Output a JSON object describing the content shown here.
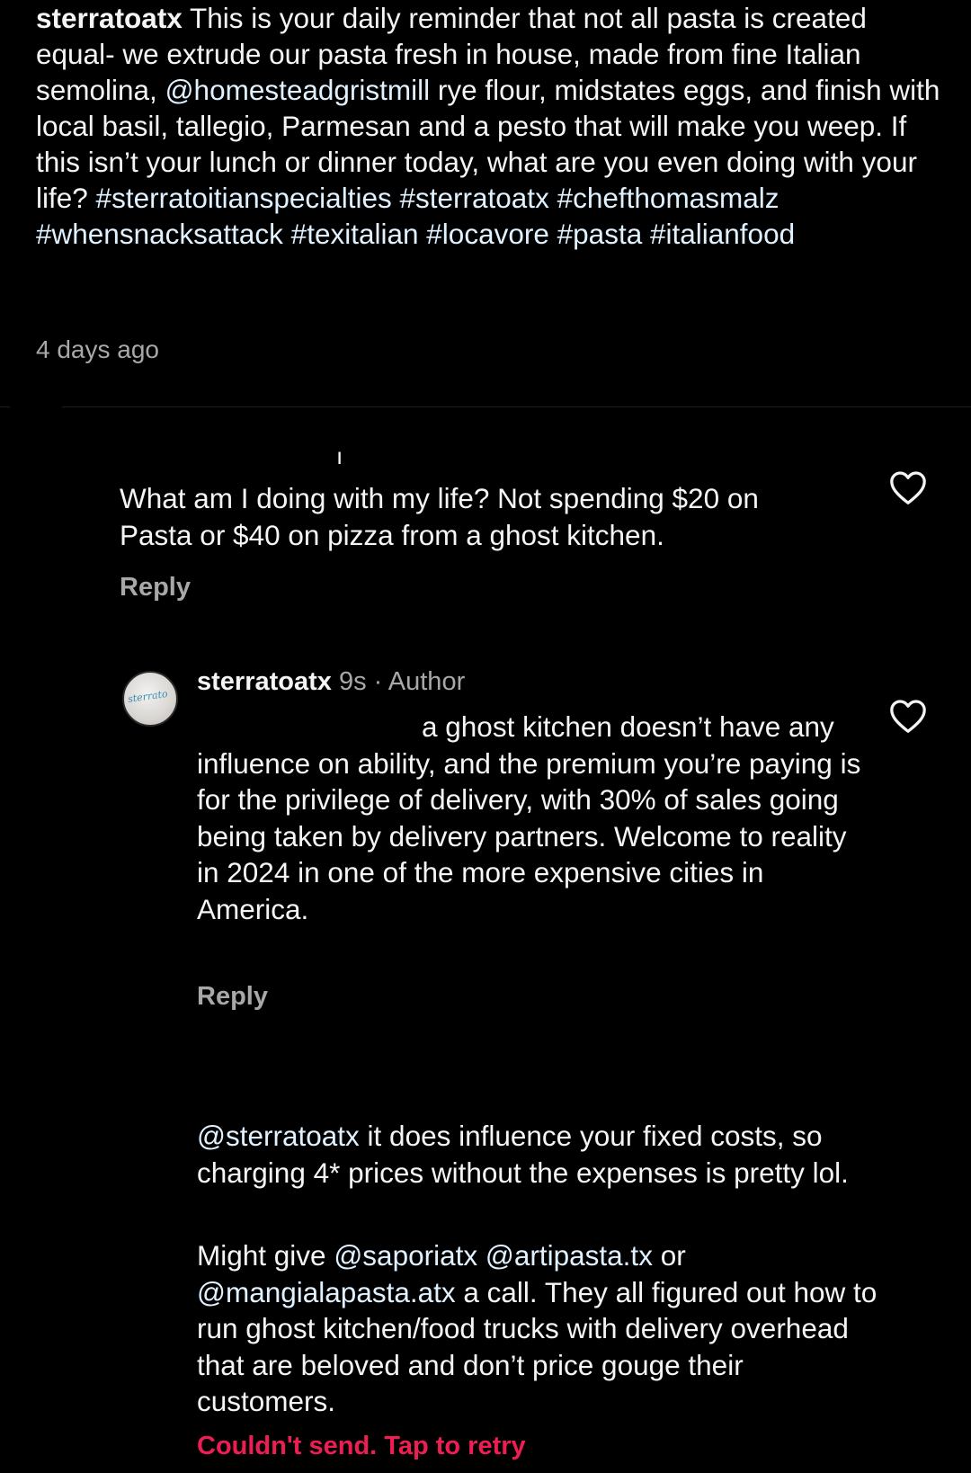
{
  "caption": {
    "username": "sterratoatx",
    "text_1": " This is your daily reminder that not all pasta is created equal- we extrude our pasta fresh in house, made from fine Italian semolina, ",
    "mention": "@homesteadgristmill",
    "text_2": " rye flour, midstates eggs, and finish with local basil, tallegio, Parmesan and a pesto that will make you weep. If this isn’t your lunch or dinner today, what are you even doing with your life? ",
    "hashtags": [
      "#sterratoitianspecialties",
      "#sterratoatx",
      "#chefthomasmalz",
      "#whensnacksattack",
      "#texitalian",
      "#locavore",
      "#pasta",
      "#italianfood"
    ],
    "timestamp": "4 days ago"
  },
  "comments": [
    {
      "text": "What am I doing with my life? Not spending $20 on Pasta or $40 on pizza from a ghost kitchen.",
      "reply_label": "Reply",
      "like_icon": "heart-outline-icon"
    },
    {
      "username": "sterratoatx",
      "time": "9s",
      "separator": " · ",
      "badge": "Author",
      "avatar_text": "sterrato",
      "text": "a ghost kitchen doesn’t have any influence on ability, and the premium you’re paying is for the privilege of delivery, with 30% of sales going being taken by delivery partners. Welcome to reality in 2024 in one of the more expensive cities in America.",
      "reply_label": "Reply",
      "like_icon": "heart-outline-icon"
    },
    {
      "mention": "@sterratoatx",
      "text_1": " it does influence your fixed costs, so charging 4* prices without the expenses is pretty lol.",
      "line_2_prefix": "Might give ",
      "mention_2": "@saporiatx",
      "mention_3": "@artipasta.tx",
      "or_text": " or ",
      "mention_4": "@mangialapasta.atx",
      "text_2": " a call. They all figured out how to run ghost kitchen/food trucks with delivery overhead that are beloved and don’t price gouge their customers.",
      "error": "Couldn't send. Tap to retry"
    }
  ],
  "colors": {
    "background": "#000000",
    "text": "#f5f5f5",
    "link": "#e0f1ff",
    "secondary": "#a8a8a8",
    "error": "#ee1d52"
  }
}
